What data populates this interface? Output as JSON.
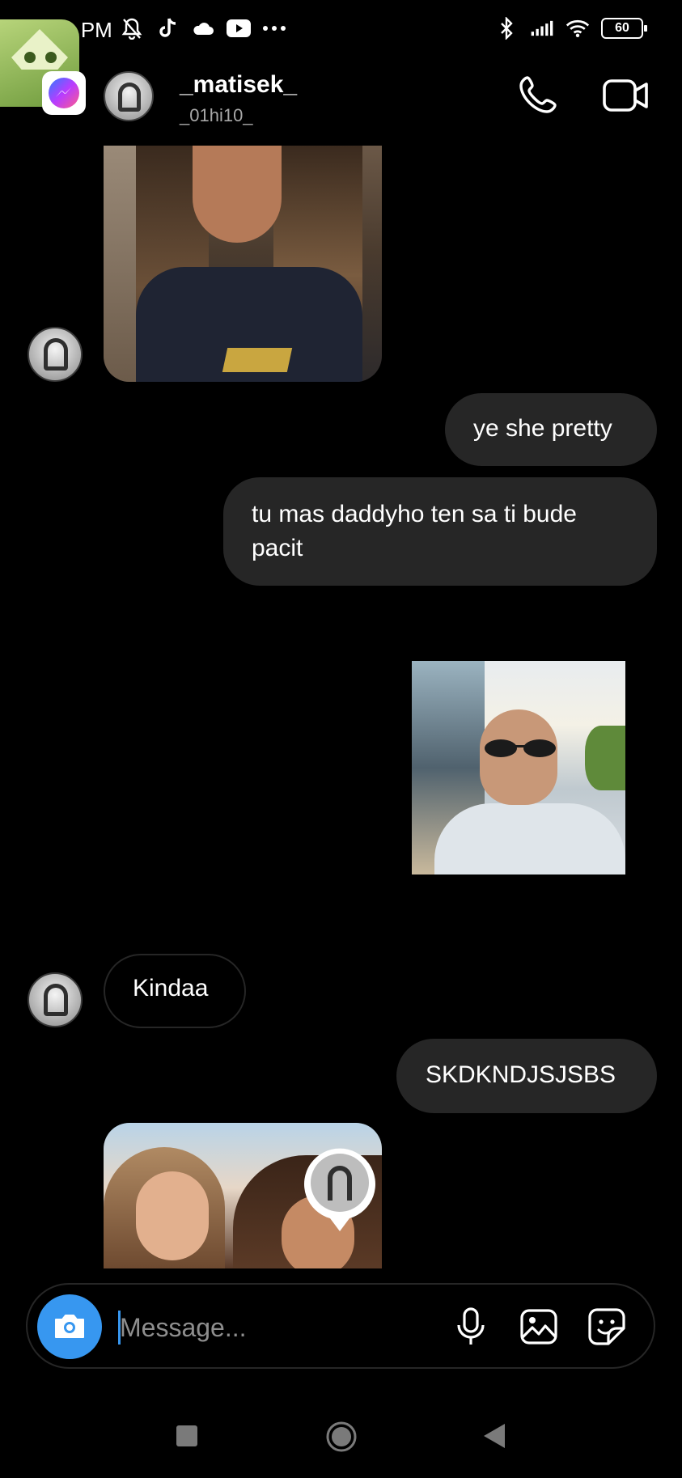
{
  "status_bar": {
    "time": "8:30 PM",
    "left_icons": [
      "bell-off-icon",
      "tiktok-icon",
      "cloud-icon",
      "youtube-icon",
      "more-dots-icon"
    ],
    "right_icons": [
      "bluetooth-icon",
      "signal-icon",
      "wifi-icon",
      "battery-icon"
    ],
    "battery": "60"
  },
  "header": {
    "display_name": "_matisek_",
    "username": "_01hi10_",
    "call_icon": "phone-icon",
    "video_icon": "video-camera-icon"
  },
  "chat_bubble_app": {
    "badge_icon": "messenger-icon"
  },
  "messages": [
    {
      "type": "image",
      "from": "them",
      "description_icon": "photo-selfie"
    },
    {
      "type": "text",
      "from": "me",
      "text": "ye she pretty"
    },
    {
      "type": "text",
      "from": "me",
      "text": "tu mas daddyho ten sa ti bude pacit"
    },
    {
      "type": "image",
      "from": "me",
      "description_icon": "photo-man-sunglasses"
    },
    {
      "type": "text",
      "from": "them",
      "text": "Kindaa"
    },
    {
      "type": "text",
      "from": "me",
      "text": "SKDKNDJSJSBS"
    },
    {
      "type": "image",
      "from": "them",
      "description_icon": "photo-two-girls"
    }
  ],
  "composer": {
    "placeholder": "Message...",
    "camera_icon": "camera-icon",
    "mic_icon": "microphone-icon",
    "gallery_icon": "gallery-icon",
    "sticker_icon": "sticker-icon"
  },
  "colors": {
    "accent": "#3797f0",
    "bubble": "#262626",
    "background": "#000000",
    "secondary_text": "#a8a8a8"
  },
  "nav": [
    "recents-icon",
    "home-icon",
    "back-icon"
  ]
}
